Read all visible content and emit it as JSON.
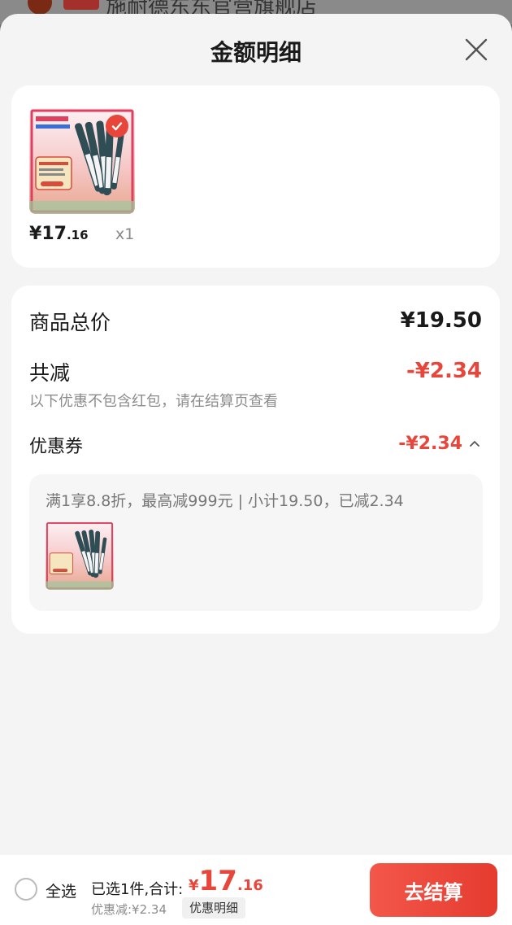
{
  "underlying_page": {
    "shop_name": "施耐德东东官营旗舰店"
  },
  "sheet": {
    "title": "金额明细"
  },
  "product": {
    "price_yen": "¥",
    "price_int": "17",
    "price_dec": ".16",
    "quantity": "x1"
  },
  "summary": {
    "subtotal_label": "商品总价",
    "subtotal_value": "¥19.50",
    "discount_label": "共减",
    "discount_value": "-¥2.34",
    "discount_note": "以下优惠不包含红包，请在结算页查看",
    "coupon_label": "优惠券",
    "coupon_value": "-¥2.34",
    "coupon_rule": "满1享8.8折，最高减999元 | 小计19.50，已减2.34"
  },
  "bottom_bar": {
    "select_all_label": "全选",
    "selected_text": "已选1件,合计:",
    "total_yen": "¥",
    "total_int": "17",
    "total_dec": ".16",
    "saved_text": "优惠减:¥2.34",
    "detail_button": "优惠明细",
    "checkout_button": "去结算"
  },
  "colors": {
    "accent": "#e8463a",
    "background": "#f4f4f4",
    "card": "#ffffff"
  },
  "icons": {
    "close": "close-icon",
    "check": "check-icon",
    "chevron": "chevron-up-icon"
  }
}
